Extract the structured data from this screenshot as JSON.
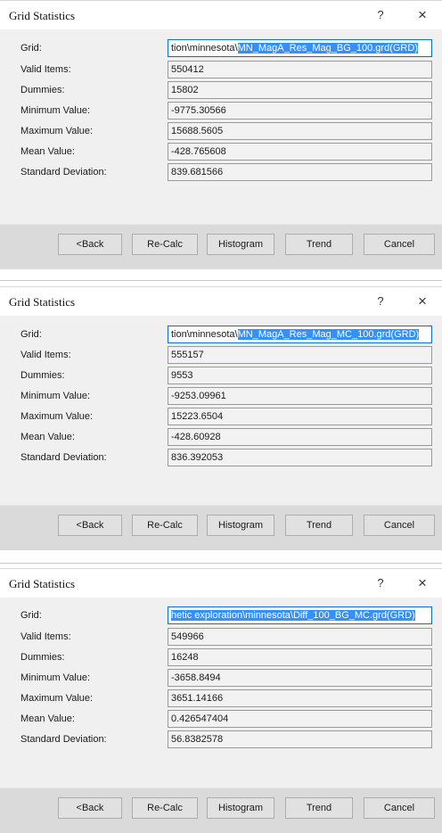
{
  "dialogs": [
    {
      "title": "Grid Statistics",
      "help": "?",
      "close": "×",
      "labels": {
        "grid": "Grid:",
        "valid": "Valid Items:",
        "dummies": "Dummies:",
        "min": "Minimum Value:",
        "max": "Maximum Value:",
        "mean": "Mean Value:",
        "std": "Standard Deviation:"
      },
      "grid_pre": "tion\\minnesota\\",
      "grid_sel": "MN_MagA_Res_Mag_BG_100.grd(GRD)",
      "values": {
        "valid": "550412",
        "dummies": "15802",
        "min": "-9775.30566",
        "max": "15688.5605",
        "mean": "-428.765608",
        "std": "839.681566"
      },
      "buttons": {
        "back": "<Back",
        "recalc": "Re-Calc",
        "histogram": "Histogram",
        "trend": "Trend",
        "cancel": "Cancel"
      }
    },
    {
      "title": "Grid Statistics",
      "help": "?",
      "close": "×",
      "labels": {
        "grid": "Grid:",
        "valid": "Valid Items:",
        "dummies": "Dummies:",
        "min": "Minimum Value:",
        "max": "Maximum Value:",
        "mean": "Mean Value:",
        "std": "Standard Deviation:"
      },
      "grid_pre": "tion\\minnesota\\",
      "grid_sel": "MN_MagA_Res_Mag_MC_100.grd(GRD)",
      "values": {
        "valid": "555157",
        "dummies": "9553",
        "min": "-9253.09961",
        "max": "15223.6504",
        "mean": "-428.60928",
        "std": "836.392053"
      },
      "buttons": {
        "back": "<Back",
        "recalc": "Re-Calc",
        "histogram": "Histogram",
        "trend": "Trend",
        "cancel": "Cancel"
      }
    },
    {
      "title": "Grid Statistics",
      "help": "?",
      "close": "×",
      "labels": {
        "grid": "Grid:",
        "valid": "Valid Items:",
        "dummies": "Dummies:",
        "min": "Minimum Value:",
        "max": "Maximum Value:",
        "mean": "Mean Value:",
        "std": "Standard Deviation:"
      },
      "grid_pre": "",
      "grid_sel": "hetic exploration\\minnesota\\Diff_100_BG_MC.grd(GRD)",
      "values": {
        "valid": "549966",
        "dummies": "16248",
        "min": "-3658.8494",
        "max": "3651.14166",
        "mean": "0.426547404",
        "std": "56.8382578"
      },
      "buttons": {
        "back": "<Back",
        "recalc": "Re-Calc",
        "histogram": "Histogram",
        "trend": "Trend",
        "cancel": "Cancel"
      }
    }
  ]
}
